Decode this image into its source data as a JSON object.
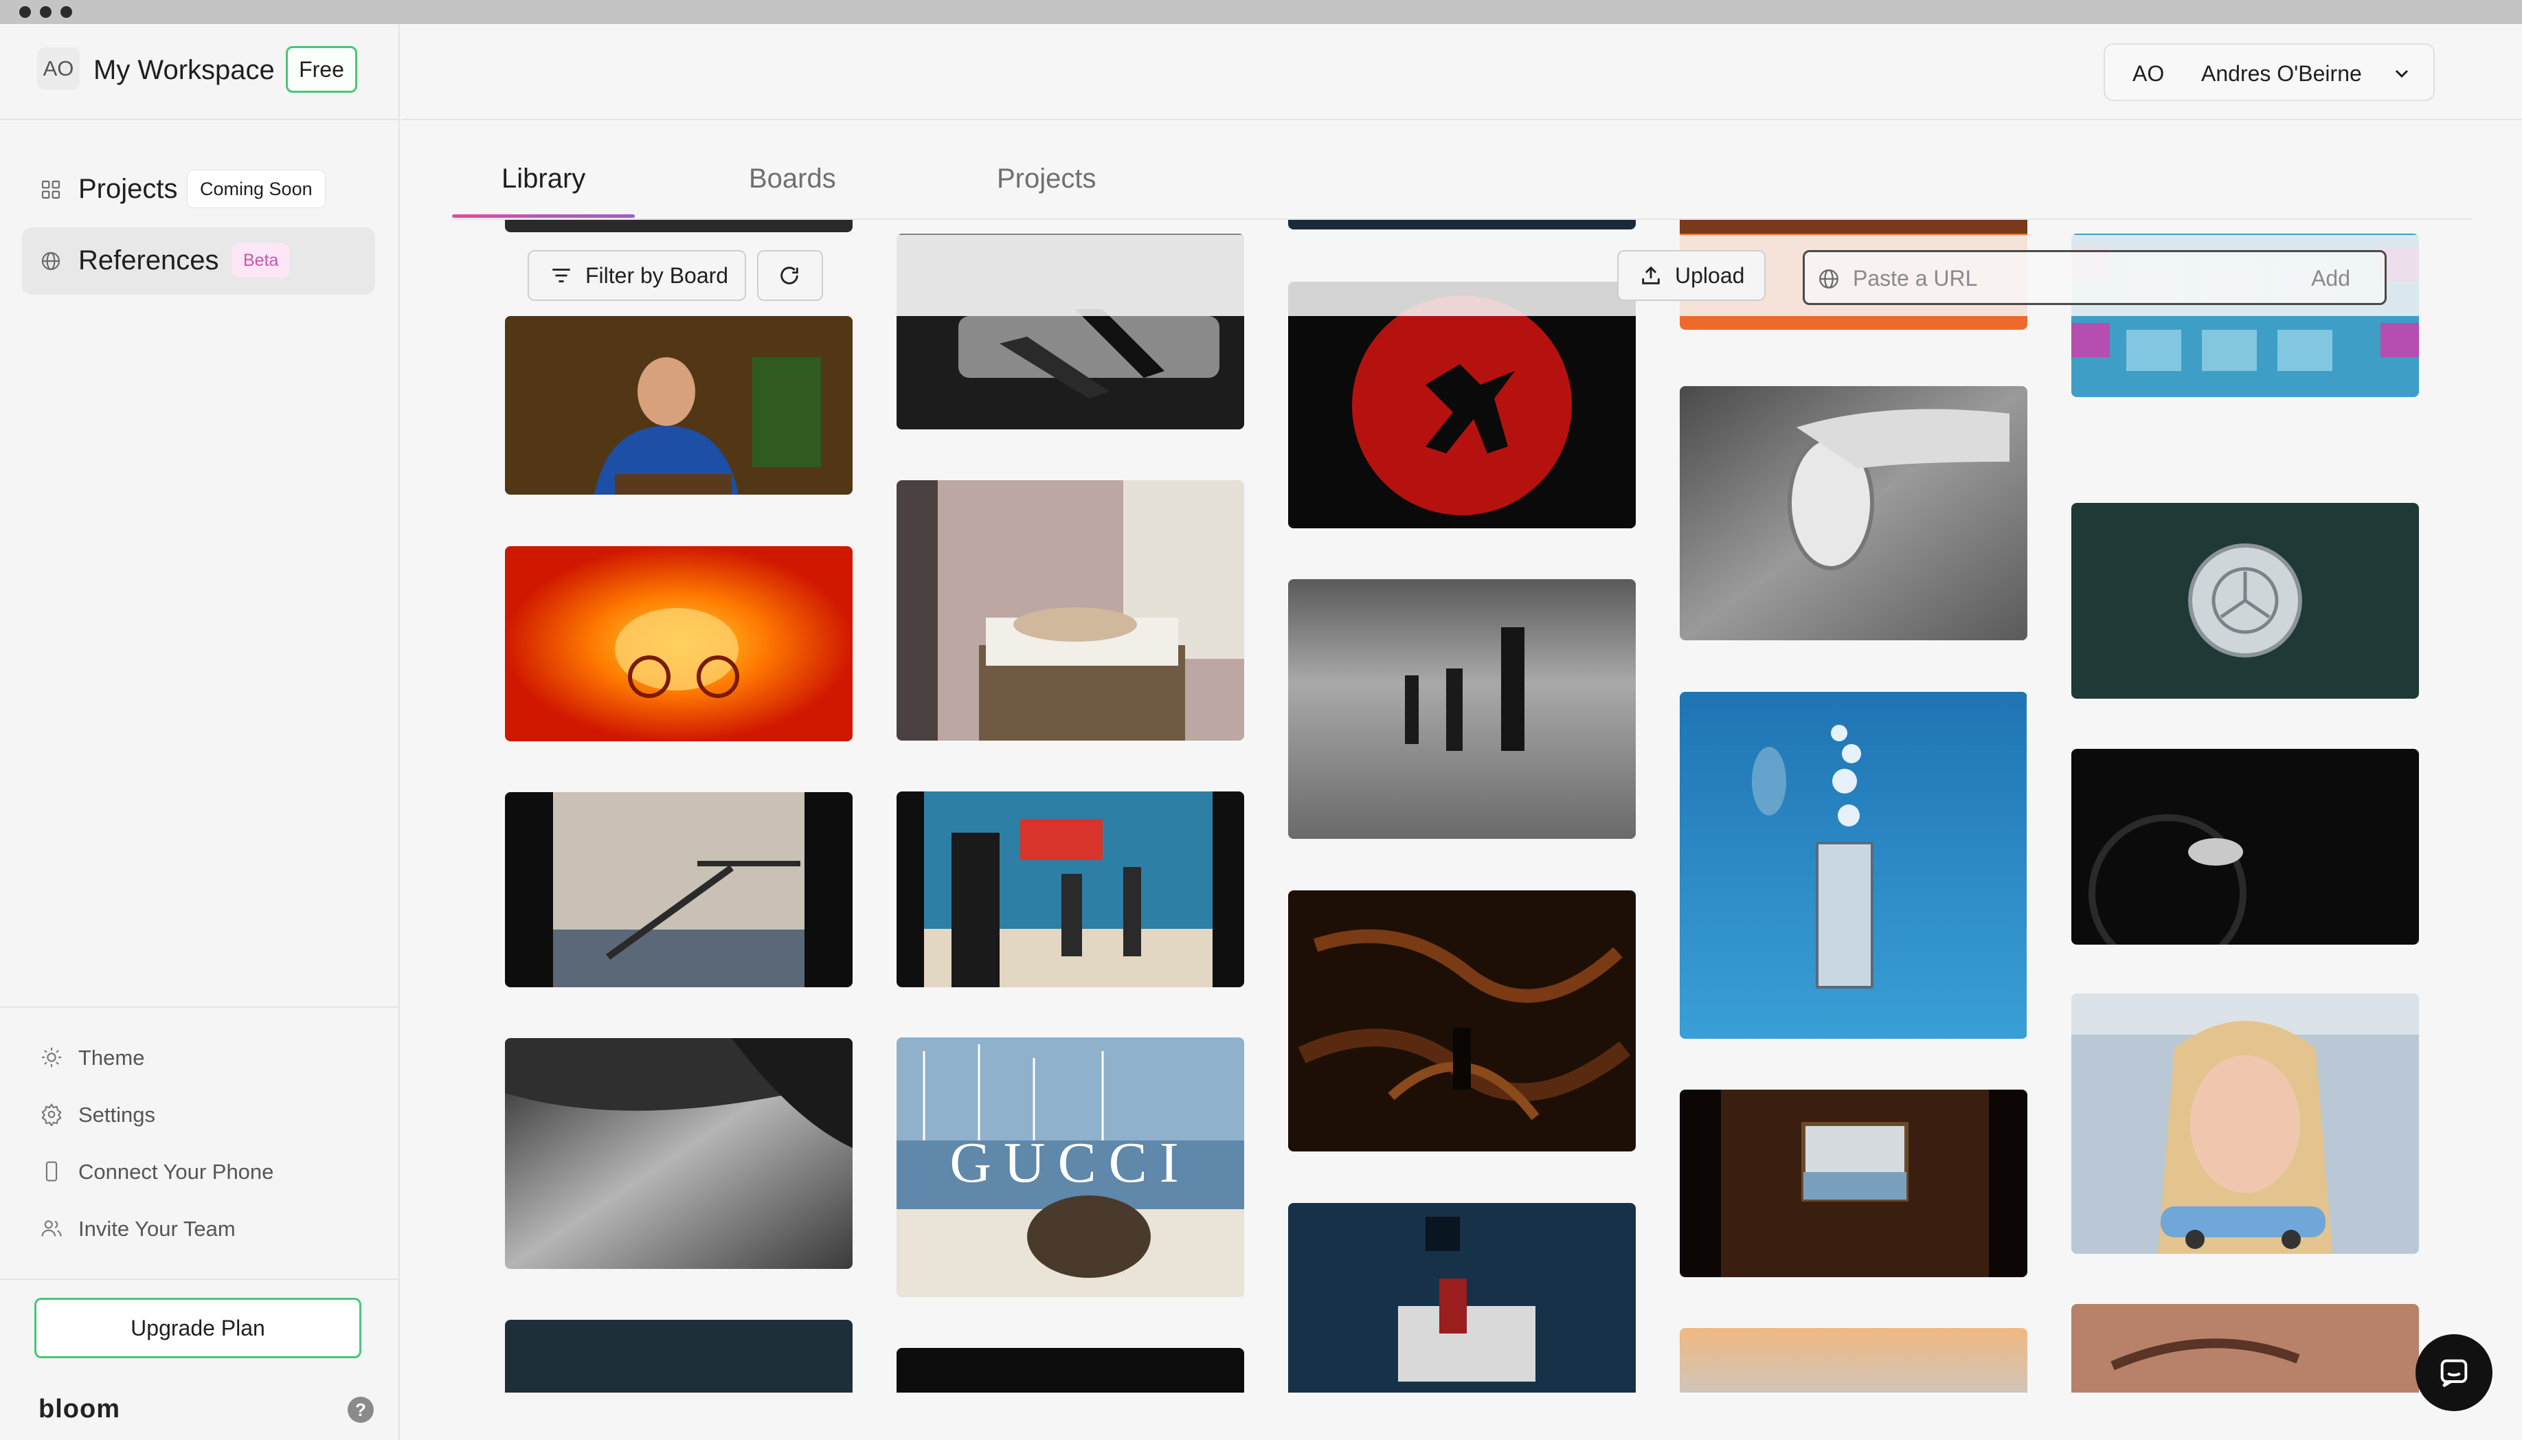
{
  "workspace": {
    "avatar": "AO",
    "title": "My Workspace",
    "plan": "Free"
  },
  "nav": {
    "projects": {
      "label": "Projects",
      "badge": "Coming Soon"
    },
    "references": {
      "label": "References",
      "badge": "Beta"
    }
  },
  "utilities": [
    {
      "label": "Theme",
      "icon": "sun-icon"
    },
    {
      "label": "Settings",
      "icon": "gear-icon"
    },
    {
      "label": "Connect Your Phone",
      "icon": "phone-icon"
    },
    {
      "label": "Invite Your Team",
      "icon": "users-icon"
    }
  ],
  "upgrade_label": "Upgrade Plan",
  "brand": "bloom",
  "help": "?",
  "user": {
    "initials": "AO",
    "name": "Andres O'Beirne"
  },
  "tabs": [
    "Library",
    "Boards",
    "Projects"
  ],
  "toolbar": {
    "filter_label": "Filter by Board",
    "upload_label": "Upload",
    "url_placeholder": "Paste a URL",
    "add_label": "Add"
  },
  "gucci_text": "GUCCI",
  "thumbnails": [
    {
      "col": 1,
      "subject": "man in blue jacket at desk"
    },
    {
      "col": 1,
      "subject": "orange motorcycle rider"
    },
    {
      "col": 1,
      "subject": "diving board over sea"
    },
    {
      "col": 1,
      "subject": "beach in black and white"
    },
    {
      "col": 2,
      "subject": "figures on sofa"
    },
    {
      "col": 2,
      "subject": "woman on bed in bedroom"
    },
    {
      "col": 2,
      "subject": "people running with flag"
    },
    {
      "col": 2,
      "subject": "Gucci boat campaign"
    },
    {
      "col": 3,
      "subject": "runner silhouette against red circle"
    },
    {
      "col": 3,
      "subject": "three men on beach"
    },
    {
      "col": 3,
      "subject": "dark forest with figure"
    },
    {
      "col": 3,
      "subject": "woman on bed in blue room"
    },
    {
      "col": 4,
      "subject": "hand holding rugby ball"
    },
    {
      "col": 4,
      "subject": "underwater phone booth"
    },
    {
      "col": 4,
      "subject": "painting in wood-panelled room"
    },
    {
      "col": 5,
      "subject": "collage grid"
    },
    {
      "col": 5,
      "subject": "Mercedes-Benz emblem"
    },
    {
      "col": 5,
      "subject": "bicycle wheel and sneakers"
    },
    {
      "col": 5,
      "subject": "woman with toy car"
    }
  ]
}
